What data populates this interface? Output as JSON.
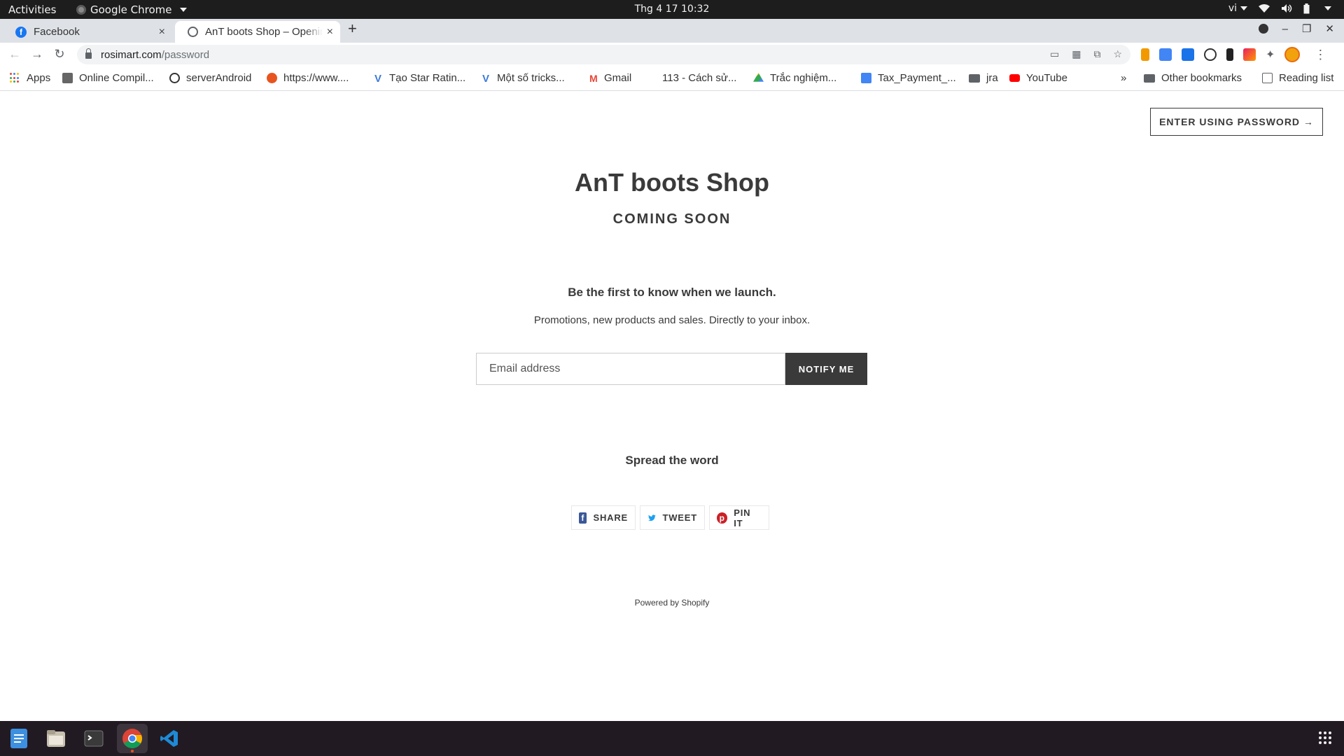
{
  "os_topbar": {
    "activities": "Activities",
    "app_name": "Google Chrome",
    "clock": "Thg 4 17  10:32",
    "lang": "vi"
  },
  "browser": {
    "tabs": [
      {
        "title": "Facebook",
        "close": "×",
        "active": false
      },
      {
        "title": "AnT boots Shop – Opening Soon",
        "close": "×",
        "active": true
      }
    ],
    "new_tab": "+",
    "url_host": "rosimart.com",
    "url_path": "/password",
    "bookmarks": [
      {
        "label": "Apps"
      },
      {
        "label": "Online Compil..."
      },
      {
        "label": "serverAndroid"
      },
      {
        "label": "https://www...."
      },
      {
        "label": "Tạo Star Ratin..."
      },
      {
        "label": "Một số tricks..."
      },
      {
        "label": "Gmail"
      },
      {
        "label": "113 - Cách sử..."
      },
      {
        "label": "Trắc nghiệm..."
      },
      {
        "label": "Tax_Payment_..."
      },
      {
        "label": "jra"
      },
      {
        "label": "YouTube"
      }
    ],
    "more_bookmarks": "»",
    "other_bookmarks": "Other bookmarks",
    "reading_list": "Reading list"
  },
  "page": {
    "enter_password_button": "ENTER USING PASSWORD →",
    "shop_title": "AnT boots Shop",
    "coming_soon": "COMING SOON",
    "launch_heading": "Be the first to know when we launch.",
    "launch_sub": "Promotions, new products and sales. Directly to your inbox.",
    "email_placeholder": "Email address",
    "email_value": "",
    "notify_button": "NOTIFY ME",
    "spread_heading": "Spread the word",
    "share_buttons": [
      {
        "label": "SHARE",
        "icon": "facebook-icon",
        "color": "#3b5998"
      },
      {
        "label": "TWEET",
        "icon": "twitter-icon",
        "color": "#1da1f2"
      },
      {
        "label": "PIN IT",
        "icon": "pinterest-icon",
        "color": "#cb2027"
      }
    ],
    "powered_by": "Powered by Shopify"
  },
  "colors": {
    "text": "#3a3a3a",
    "notify_bg": "#3a3a3a",
    "os_bar": "#1d1d1d",
    "taskbar": "#221a22",
    "tab_strip": "#dee1e6"
  }
}
